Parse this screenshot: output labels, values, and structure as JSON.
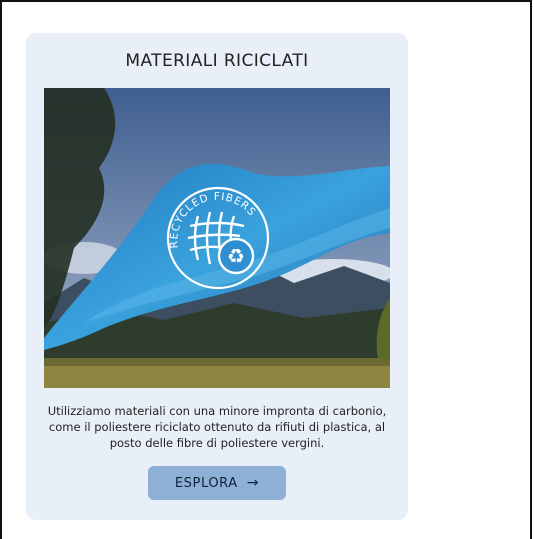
{
  "card": {
    "title": "MATERIALI RICICLATI",
    "image": {
      "badge_text": "RECYCLED FIBERS",
      "colors": {
        "sky": "#4a6a9a",
        "fabric": "#2f8fd0",
        "mountains": "#3c4e60",
        "field": "#b8a24a"
      }
    },
    "description_lines": [
      "Utilizziamo materiali con una minore impronta di carbonio,",
      "come il poliestere riciclato ottenuto da rifiuti di plastica, al",
      "posto delle fibre di poliestere vergini."
    ],
    "button": {
      "label": "ESPLORA",
      "icon": "arrow-right-icon",
      "arrow_glyph": "→"
    }
  },
  "colors": {
    "card_bg": "#e9eff8",
    "button_bg": "#8eb0d6"
  }
}
